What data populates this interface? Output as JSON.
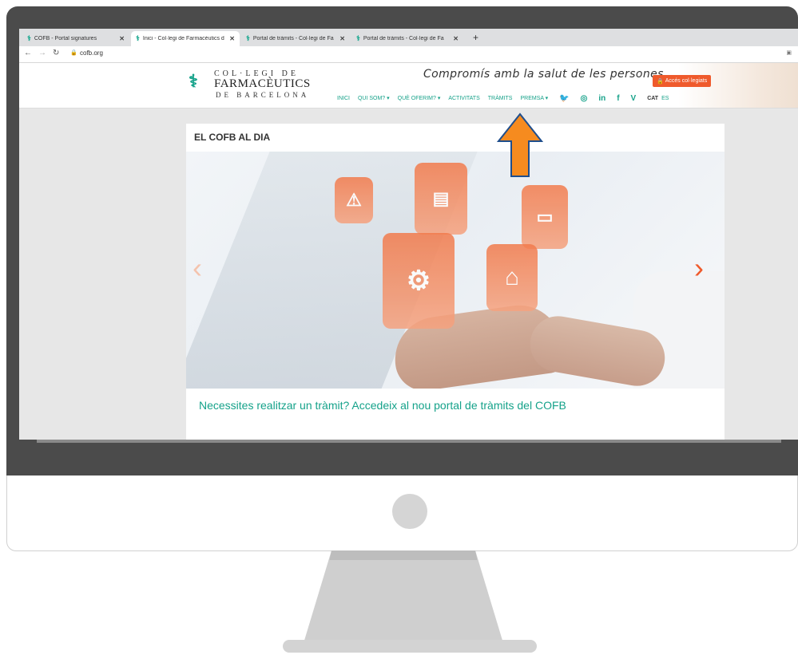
{
  "browser": {
    "tabs": [
      {
        "title": "COFB - Portal signatures",
        "active": false
      },
      {
        "title": "Inici - Col·legi de Farmacèutics d",
        "active": true
      },
      {
        "title": "Portal de tràmits - Col·legi de Fa",
        "active": false
      },
      {
        "title": "Portal de tràmits - Col·legi de Fa",
        "active": false
      }
    ],
    "new_tab": "+",
    "url": "cofb.org"
  },
  "site": {
    "logo": {
      "line1": "COL·LEGI DE",
      "line2": "FARMACÈUTICS",
      "line3": "DE BARCELONA"
    },
    "slogan": "Compromís amb la salut de les persones",
    "access_button": "Accés col·legiats",
    "menu": [
      {
        "label": "INICI"
      },
      {
        "label": "QUI SOM? ▾"
      },
      {
        "label": "QUÈ OFERIM? ▾"
      },
      {
        "label": "ACTIVITATS"
      },
      {
        "label": "TRÀMITS"
      },
      {
        "label": "PREMSA ▾"
      }
    ],
    "social": [
      {
        "name": "twitter-icon",
        "glyph": "🐦"
      },
      {
        "name": "instagram-icon",
        "glyph": "◎"
      },
      {
        "name": "linkedin-icon",
        "glyph": "in"
      },
      {
        "name": "facebook-icon",
        "glyph": "f"
      },
      {
        "name": "vimeo-icon",
        "glyph": "V"
      }
    ],
    "lang_current": "CAT",
    "lang_other": "ES"
  },
  "main": {
    "section_title": "EL COFB AL DIA",
    "carousel_caption": "Necessites realitzar un tràmit? Accedeix al nou portal de tràmits del COFB",
    "prev_arrow": "‹",
    "next_arrow": "›",
    "tiles": [
      {
        "name": "warning-tile-icon",
        "glyph": "⚠"
      },
      {
        "name": "document-check-tile-icon",
        "glyph": "▤"
      },
      {
        "name": "id-card-tile-icon",
        "glyph": "▭"
      },
      {
        "name": "gear-user-tile-icon",
        "glyph": "⚙"
      },
      {
        "name": "pharmacy-store-tile-icon",
        "glyph": "⌂"
      }
    ]
  },
  "colors": {
    "accent": "#15a28a",
    "orange": "#ef5a2c",
    "annotation": "#f68b1f"
  }
}
